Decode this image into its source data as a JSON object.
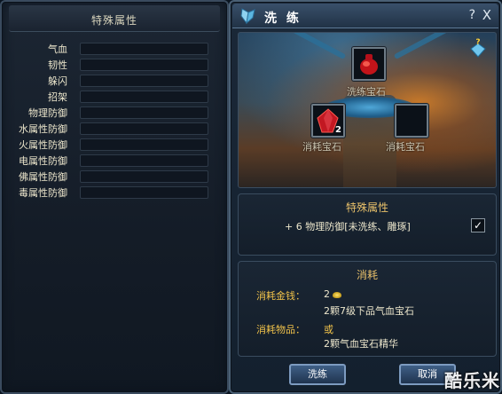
{
  "left_panel": {
    "title": "特殊属性",
    "attributes": [
      {
        "label": "气血"
      },
      {
        "label": "韧性"
      },
      {
        "label": "躲闪"
      },
      {
        "label": "招架"
      },
      {
        "label": "物理防御"
      },
      {
        "label": "水属性防御"
      },
      {
        "label": "火属性防御"
      },
      {
        "label": "电属性防御"
      },
      {
        "label": "佛属性防御"
      },
      {
        "label": "毒属性防御"
      }
    ]
  },
  "right_panel": {
    "title": "洗 练",
    "help_symbol": "?",
    "close_symbol": "X",
    "slots": {
      "main_label": "洗练宝石",
      "left_label": "消耗宝石",
      "left_count": "2",
      "right_label": "消耗宝石"
    },
    "special": {
      "title": "特殊属性",
      "line": "+ 6  物理防御[未洗练、雕琢]",
      "checked_symbol": "✓"
    },
    "cost": {
      "title": "消耗",
      "money_label": "消耗金钱：",
      "money_value": "2",
      "money_item": "2颗7级下品气血宝石",
      "items_label": "消耗物品：",
      "items_or": "或",
      "items_value": "2颗气血宝石精华"
    },
    "buttons": {
      "wash": "洗练",
      "cancel": "取消"
    }
  },
  "watermark": "酷乐米",
  "colors": {
    "accent_gold": "#f0c24a",
    "title_gold": "#e8c06a",
    "button_blue": "#3f5f86"
  }
}
